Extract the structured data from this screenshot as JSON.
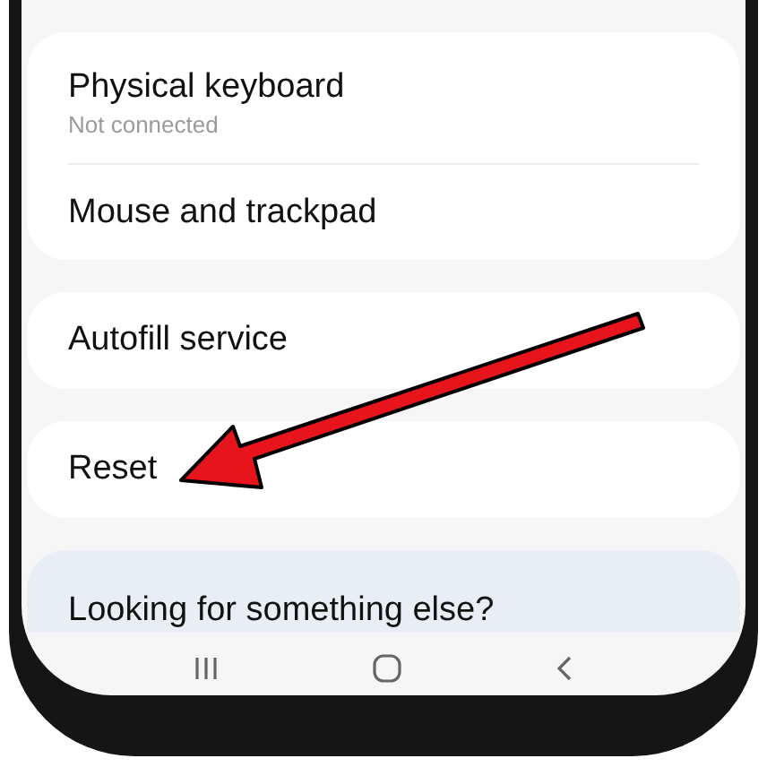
{
  "groups": [
    {
      "items": [
        {
          "title": "Physical keyboard",
          "subtitle": "Not connected"
        },
        {
          "title": "Mouse and trackpad"
        }
      ]
    },
    {
      "items": [
        {
          "title": "Autofill service"
        }
      ]
    },
    {
      "items": [
        {
          "title": "Reset"
        }
      ]
    }
  ],
  "suggestion": {
    "title": "Looking for something else?"
  }
}
